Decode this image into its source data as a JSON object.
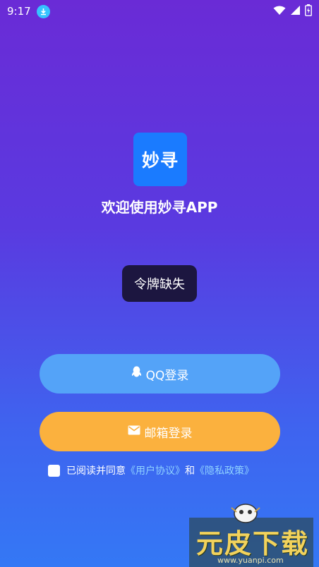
{
  "status_bar": {
    "time": "9:17"
  },
  "app": {
    "logo_text": "妙寻",
    "welcome": "欢迎使用妙寻APP"
  },
  "toast": {
    "message": "令牌缺失"
  },
  "buttons": {
    "qq_login": "QQ登录",
    "email_login": "邮箱登录"
  },
  "agreement": {
    "prefix": "已阅读并同意",
    "user_agreement": "《用户协议》",
    "conjunction": "和",
    "privacy_policy": "《隐私政策》",
    "checked": false
  },
  "watermark": {
    "text": "元皮下载",
    "url": "www.yuanpi.com"
  },
  "colors": {
    "logo_bg": "#1a7bff",
    "qq_button": "#54a3f8",
    "email_button": "#fbb13e",
    "toast_bg": "#1c1640",
    "link": "#8fd2ff"
  }
}
